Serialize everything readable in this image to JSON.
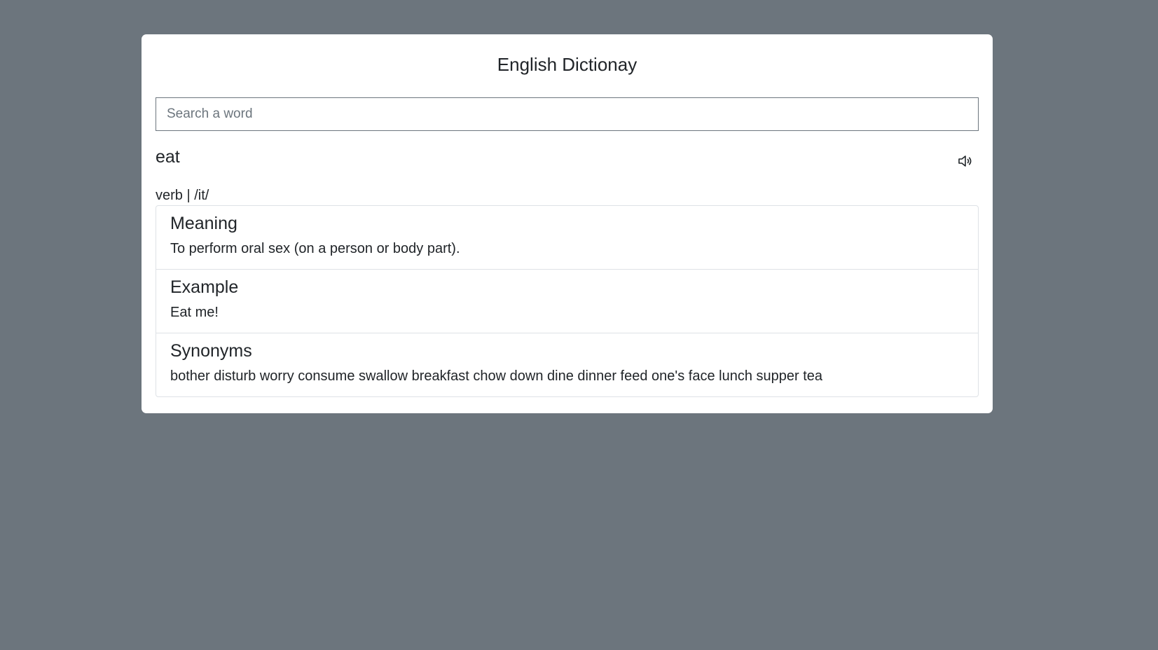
{
  "app": {
    "title": "English Dictionay"
  },
  "search": {
    "placeholder": "Search a word",
    "value": ""
  },
  "result": {
    "word": "eat",
    "part_of_speech_line": "verb | /it/",
    "audio_icon": "speaker-icon",
    "sections": [
      {
        "heading": "Meaning",
        "text": "To perform oral sex (on a person or body part)."
      },
      {
        "heading": "Example",
        "text": "Eat me!"
      },
      {
        "heading": "Synonyms",
        "text": "bother disturb worry consume swallow breakfast chow down dine dinner feed one's face lunch supper tea"
      }
    ]
  },
  "colors": {
    "background": "#6c757d",
    "card": "#ffffff",
    "text": "#212529",
    "border": "#dee2e6"
  }
}
